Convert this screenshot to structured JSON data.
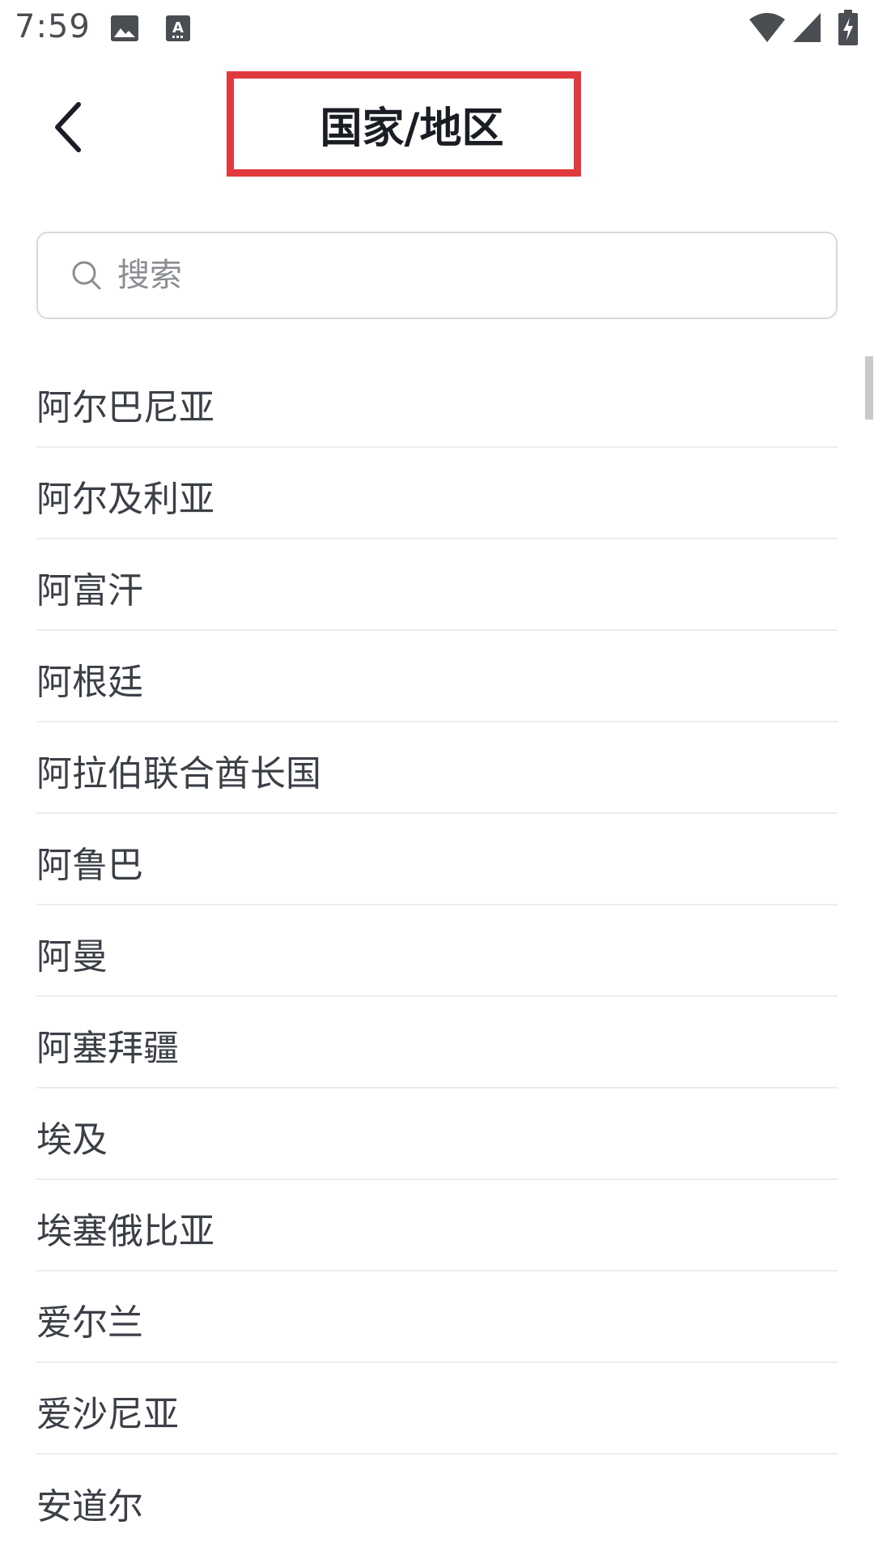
{
  "status_bar": {
    "time": "7:59",
    "icons": [
      "image-icon",
      "text-a-icon",
      "wifi-icon",
      "cellular-signal-icon",
      "battery-charging-icon"
    ]
  },
  "header": {
    "back_icon": "chevron-left-icon",
    "title": "国家/地区",
    "highlight_color": "#e03a3e"
  },
  "search": {
    "icon": "search-icon",
    "placeholder": "搜索",
    "value": ""
  },
  "countries": [
    "阿尔巴尼亚",
    "阿尔及利亚",
    "阿富汗",
    "阿根廷",
    "阿拉伯联合酋长国",
    "阿鲁巴",
    "阿曼",
    "阿塞拜疆",
    "埃及",
    "埃塞俄比亚",
    "爱尔兰",
    "爱沙尼亚",
    "安道尔"
  ]
}
